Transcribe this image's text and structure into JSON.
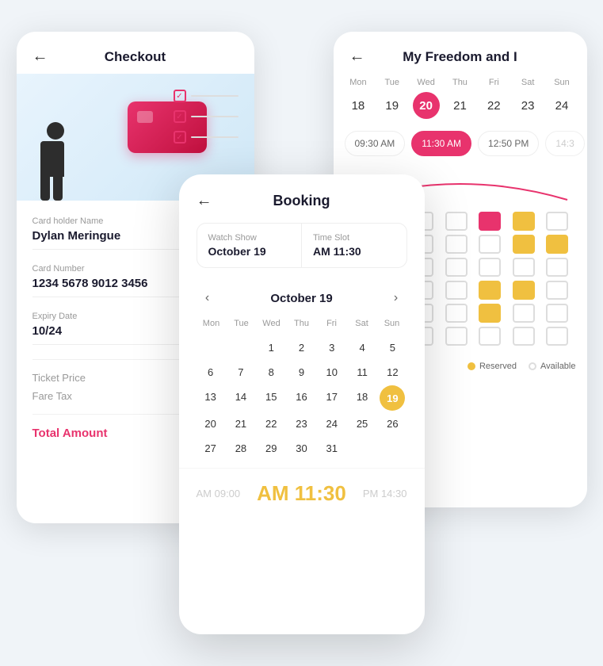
{
  "checkout": {
    "title": "Checkout",
    "back_arrow": "←",
    "card_holder_label": "Card holder Name",
    "card_holder_value": "Dylan Meringue",
    "card_number_label": "Card Number",
    "card_number_value": "1234 5678 9012 3456",
    "expiry_label": "Expiry Date",
    "expiry_value": "10/24",
    "ticket_price_label": "Ticket Price",
    "fare_tax_label": "Fare Tax",
    "total_label": "Total Amount",
    "checklist": [
      "✓",
      "✓",
      "✓"
    ]
  },
  "schedule": {
    "title": "My Freedom and I",
    "back_arrow": "←",
    "days": [
      {
        "name": "Mon",
        "num": "18"
      },
      {
        "name": "Tue",
        "num": "19"
      },
      {
        "name": "Wed",
        "num": "20",
        "active": true
      },
      {
        "name": "Thu",
        "num": "21"
      },
      {
        "name": "Fri",
        "num": "22"
      },
      {
        "name": "Sat",
        "num": "23"
      },
      {
        "name": "Sun",
        "num": "24"
      }
    ],
    "time_slots": [
      {
        "time": "09:30 AM",
        "active": false
      },
      {
        "time": "11:30 AM",
        "active": true
      },
      {
        "time": "12:50 PM",
        "active": false
      },
      {
        "time": "14:3",
        "active": false,
        "disabled": true
      }
    ],
    "legend": {
      "reserved_label": "Reserved",
      "available_label": "Available"
    }
  },
  "booking": {
    "title": "Booking",
    "back_arrow": "←",
    "watch_show_label": "Watch Show",
    "watch_show_value": "October 19",
    "time_slot_label": "Time Slot",
    "time_slot_value": "AM 11:30",
    "calendar": {
      "month": "October 19",
      "prev": "‹",
      "next": "›",
      "day_headers": [
        "Mon",
        "Tue",
        "Wed",
        "Thu",
        "Fri",
        "Sat",
        "Sun"
      ],
      "weeks": [
        [
          "",
          "",
          "1",
          "2",
          "3",
          "4",
          "5"
        ],
        [
          "6",
          "7",
          "8",
          "9",
          "10",
          "11",
          "12"
        ],
        [
          "13",
          "14",
          "15",
          "16",
          "17",
          "18",
          "19"
        ],
        [
          "20",
          "21",
          "22",
          "23",
          "24",
          "25",
          "26"
        ],
        [
          "27",
          "28",
          "29",
          "30",
          "31",
          "",
          ""
        ]
      ],
      "active_day": "19"
    },
    "time_left": "AM 09:00",
    "time_center": "AM 11:30",
    "time_right": "PM 14:30"
  },
  "colors": {
    "accent_pink": "#e8336d",
    "accent_yellow": "#f0c040",
    "text_dark": "#1a1a2e",
    "text_gray": "#999999"
  }
}
